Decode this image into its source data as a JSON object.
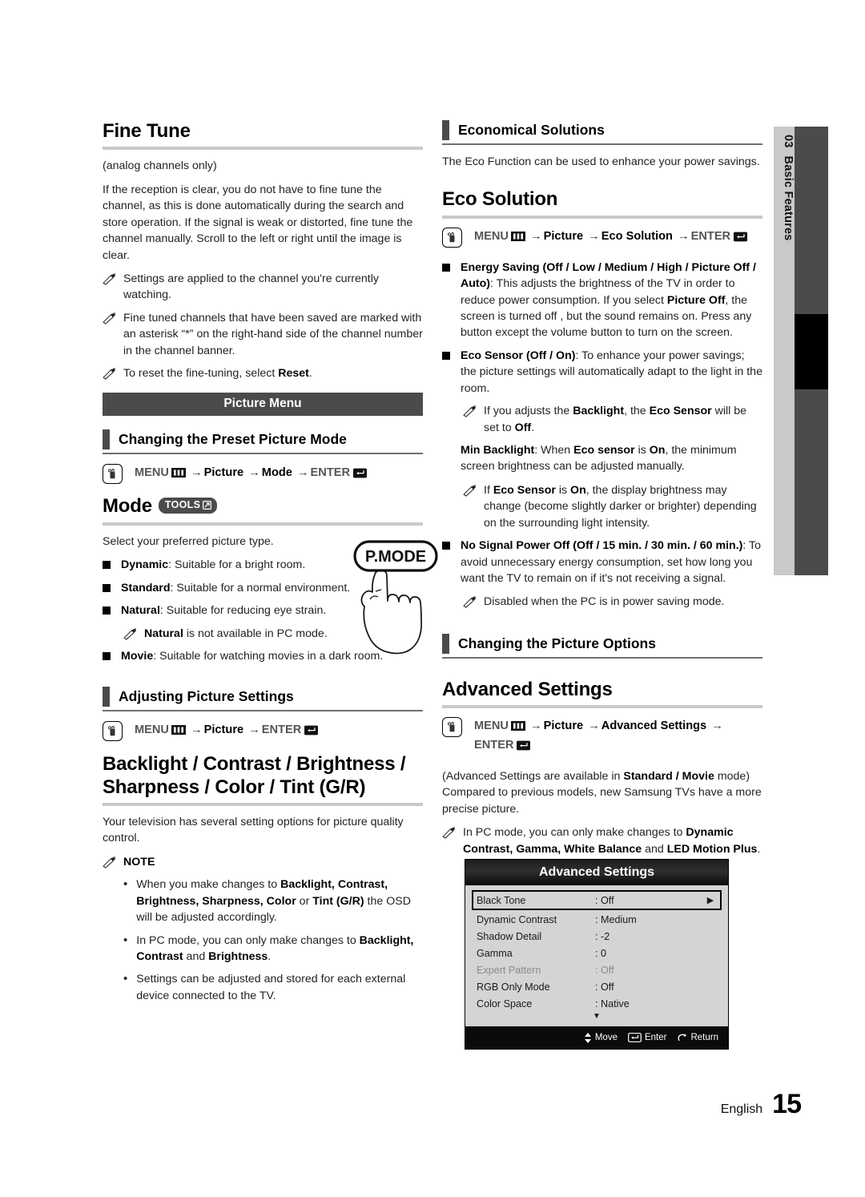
{
  "chapter_tab": {
    "number": "03",
    "title": "Basic Features"
  },
  "footer": {
    "language": "English",
    "page_number": "15"
  },
  "left_column": {
    "fine_tune": {
      "title": "Fine Tune",
      "subtitle": "(analog channels only)",
      "body": "If the reception is clear, you do not have to fine tune the channel, as this is done automatically during the search and store operation. If the signal is weak or distorted, fine tune the channel manually. Scroll to the left or right until the image is clear.",
      "notes": [
        "Settings are applied to the channel you're currently watching.",
        "Fine tuned channels that have been saved are marked with an asterisk “*” on the right-hand side of the channel number in the channel banner.",
        "To reset the fine-tuning, select Reset."
      ]
    },
    "picture_menu_banner": "Picture Menu",
    "preset_picture_mode": {
      "subhead": "Changing the Preset Picture Mode",
      "path": [
        "MENU",
        "Picture",
        "Mode",
        "ENTER"
      ]
    },
    "mode": {
      "title": "Mode",
      "badge": "TOOLS",
      "intro": "Select your preferred picture type.",
      "options": [
        {
          "name": "Dynamic",
          "desc": ": Suitable for a bright room."
        },
        {
          "name": "Standard",
          "desc": ": Suitable for a normal environment."
        },
        {
          "name": "Natural",
          "desc": ": Suitable for reducing eye strain."
        },
        {
          "name": "Movie",
          "desc": ": Suitable for watching movies in a dark room."
        }
      ],
      "natural_note": "Natural is not available in PC mode.",
      "remote_button_label": "P.MODE"
    },
    "adjusting_picture_settings": {
      "subhead": "Adjusting Picture Settings",
      "path": [
        "MENU",
        "Picture",
        "ENTER"
      ]
    },
    "backlight_group": {
      "title_line1": "Backlight / Contrast / Brightness /",
      "title_line2": "Sharpness / Color / Tint (G/R)",
      "body": "Your television has several setting options for picture quality control.",
      "note_heading": "NOTE",
      "bullets": [
        "When you make changes to Backlight, Contrast, Brightness, Sharpness, Color or Tint (G/R) the OSD will be adjusted accordingly.",
        "In PC mode, you can only make changes to Backlight, Contrast and Brightness.",
        "Settings can be adjusted and stored for each external device connected to the TV."
      ]
    }
  },
  "right_column": {
    "economical_solutions": {
      "subhead": "Economical Solutions",
      "body": "The Eco Function can be used to enhance your power savings."
    },
    "eco_solution": {
      "title": "Eco Solution",
      "path": [
        "MENU",
        "Picture",
        "Eco Solution",
        "ENTER"
      ],
      "energy_saving": {
        "name": "Energy Saving (Off / Low / Medium / High / Picture Off / Auto)",
        "desc": ": This adjusts the brightness of the TV in order to reduce power consumption. If you select Picture Off, the screen is turned off , but the sound remains on. Press any button except the volume button to turn on the screen."
      },
      "eco_sensor": {
        "name": "Eco Sensor (Off / On)",
        "desc": ": To enhance your power savings; the picture settings will automatically adapt to the light in the room.",
        "note": "If you adjusts the Backlight, the Eco Sensor will be set to Off.",
        "min_backlight": "Min Backlight: When Eco sensor is On, the minimum screen brightness can be adjusted manually.",
        "min_backlight_note": "If Eco Sensor is On, the display brightness may change (become slightly darker or brighter) depending on the surrounding light intensity."
      },
      "no_signal_power_off": {
        "name": "No Signal Power Off (Off / 15 min. / 30 min. / 60 min.)",
        "desc": ": To avoid unnecessary energy consumption, set how long you want the TV to remain on if it's not receiving a signal.",
        "note": "Disabled when the PC is in power saving mode."
      }
    },
    "picture_options": {
      "subhead": "Changing the Picture Options"
    },
    "advanced_settings": {
      "title": "Advanced Settings",
      "path": [
        "MENU",
        "Picture",
        "Advanced Settings",
        "ENTER"
      ],
      "body1": "(Advanced Settings are available in Standard / Movie mode)",
      "body2": "Compared to previous models, new Samsung TVs have a more precise picture.",
      "note": "In PC mode, you can only make changes to Dynamic Contrast, Gamma, White Balance and LED Motion Plus."
    }
  },
  "osd_screenshot": {
    "title": "Advanced Settings",
    "rows": [
      {
        "label": "Black Tone",
        "value": ": Off",
        "selected": true,
        "disabled": false
      },
      {
        "label": "Dynamic Contrast",
        "value": ": Medium",
        "selected": false,
        "disabled": false
      },
      {
        "label": "Shadow Detail",
        "value": ": -2",
        "selected": false,
        "disabled": false
      },
      {
        "label": "Gamma",
        "value": ": 0",
        "selected": false,
        "disabled": false
      },
      {
        "label": "Expert Pattern",
        "value": ": Off",
        "selected": false,
        "disabled": true
      },
      {
        "label": "RGB Only Mode",
        "value": ": Off",
        "selected": false,
        "disabled": false
      },
      {
        "label": "Color Space",
        "value": ": Native",
        "selected": false,
        "disabled": false
      }
    ],
    "footer_actions": [
      {
        "icon": "updown-arrow-icon",
        "label": "Move"
      },
      {
        "icon": "enter-icon",
        "label": "Enter"
      },
      {
        "icon": "return-icon",
        "label": "Return"
      }
    ]
  }
}
